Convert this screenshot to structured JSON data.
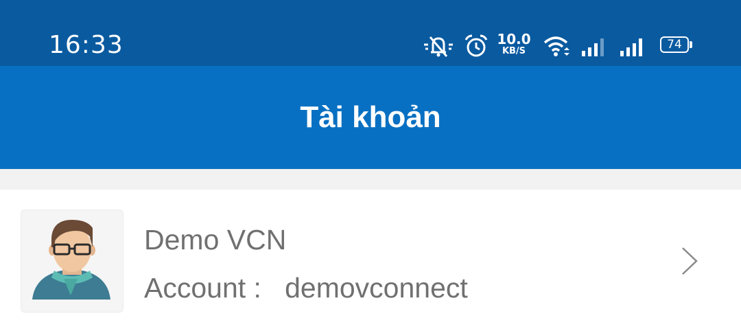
{
  "status_bar": {
    "time": "16:33",
    "net_speed_value": "10.0",
    "net_speed_unit": "KB/S",
    "battery_level": "74",
    "icons": [
      "bell-muted-icon",
      "alarm-icon",
      "wifi-icon",
      "signal-icon",
      "signal-icon",
      "battery-icon"
    ]
  },
  "header": {
    "title": "Tài khoản"
  },
  "account": {
    "name": "Demo VCN",
    "account_label": "Account :",
    "account_value": "demovconnect",
    "avatar_icon": "avatar-icon",
    "chevron_icon": "chevron-right-icon"
  },
  "colors": {
    "status_bar_bg": "#0a5aa0",
    "header_bg": "#0870c2",
    "divider_bg": "#f2f2f2",
    "text_gray": "#707070"
  }
}
